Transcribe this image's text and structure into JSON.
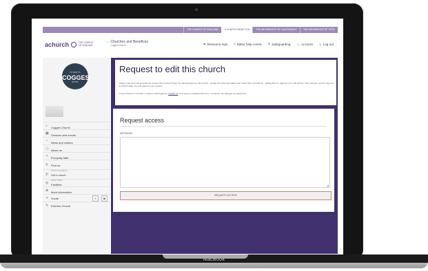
{
  "device": {
    "brand": "MacBook"
  },
  "top_bar": {
    "links": [
      {
        "label": "THE CHURCH OF ENGLAND",
        "active": false
      },
      {
        "label": "A CHURCH NEAR YOU",
        "active": true
      },
      {
        "label": "THE ARCHBISHOP OF CANTERBURY",
        "active": false
      },
      {
        "label": "THE ARCHBISHOP OF YORK",
        "active": false
      }
    ]
  },
  "header": {
    "logo_text": "achurch",
    "logo_coe_line1": "THE CHURCH",
    "logo_coe_line2": "OF ENGLAND",
    "cab_title": "Churches and Benefices",
    "cab_sub": "Cogges Church",
    "nav": [
      {
        "icon": "flag-icon",
        "glyph": "⚑",
        "label": "Resource Hub"
      },
      {
        "icon": "help-icon",
        "glyph": "?",
        "label": "Editor help centre"
      },
      {
        "icon": "shield-icon",
        "glyph": "⛨",
        "label": "Safeguarding"
      },
      {
        "icon": "user-icon",
        "glyph": "☺",
        "label": "Account"
      },
      {
        "icon": "logout-icon",
        "glyph": "↳",
        "label": "Log out"
      }
    ]
  },
  "sidebar": {
    "badge": {
      "top": "ST MARY'S",
      "main": "COGGES",
      "sub": "WITNEY"
    },
    "items": [
      {
        "icon": "home-icon",
        "glyph": "⌂",
        "label": "Cogges Church",
        "sub": ""
      },
      {
        "icon": "calendar-icon",
        "glyph": "▦",
        "label": "Services and events",
        "sub": ""
      },
      {
        "icon": "news-icon",
        "glyph": "◔",
        "label": "News and notices",
        "sub": ""
      },
      {
        "icon": "info-icon",
        "glyph": "ⓘ",
        "label": "About us",
        "sub": ""
      },
      {
        "icon": "faith-icon",
        "glyph": "✧",
        "label": "Everyday faith",
        "sub": ""
      },
      {
        "icon": "location-icon",
        "glyph": "⚲",
        "label": "Find us",
        "sub": "Church Lane Witney"
      },
      {
        "icon": "phone-icon",
        "glyph": "✆",
        "label": "Get in touch",
        "sub": "01993 779813"
      },
      {
        "icon": "facilities-icon",
        "glyph": "◎",
        "label": "Facilities",
        "sub": ""
      },
      {
        "icon": "more-icon",
        "glyph": "⊕",
        "label": "More information",
        "sub": ""
      }
    ],
    "social": {
      "label": "Social",
      "glyph": "≺",
      "facebook": "f",
      "instagram": "◙"
    },
    "edit": {
      "glyph": "✎",
      "label": "Edit this Church"
    }
  },
  "main": {
    "title": "Request to edit this church",
    "intro_p1": "Filling in the form will generate an email to the A Church Near You administrator for this church - usually the vicar who leads your church (the 'incumbent') - asking them to approve your edit access. They will then need to log in to A Church Near You and approve your request.",
    "intro_p2_before": "If your church is currently in vacancy (interregnum), ",
    "intro_p2_link": "contact us",
    "intro_p2_after": " once you've completed this form, so that we can help get you approved.",
    "form_title": "Request access",
    "message_label": "MESSAGE*",
    "message_value": "",
    "submit_label": "REQUEST ACCESS"
  }
}
